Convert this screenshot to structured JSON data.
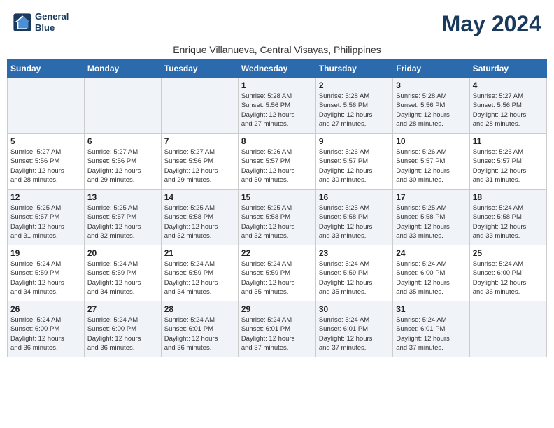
{
  "header": {
    "logo_line1": "General",
    "logo_line2": "Blue",
    "month_title": "May 2024",
    "subtitle": "Enrique Villanueva, Central Visayas, Philippines"
  },
  "weekdays": [
    "Sunday",
    "Monday",
    "Tuesday",
    "Wednesday",
    "Thursday",
    "Friday",
    "Saturday"
  ],
  "weeks": [
    [
      {
        "day": "",
        "info": ""
      },
      {
        "day": "",
        "info": ""
      },
      {
        "day": "",
        "info": ""
      },
      {
        "day": "1",
        "info": "Sunrise: 5:28 AM\nSunset: 5:56 PM\nDaylight: 12 hours\nand 27 minutes."
      },
      {
        "day": "2",
        "info": "Sunrise: 5:28 AM\nSunset: 5:56 PM\nDaylight: 12 hours\nand 27 minutes."
      },
      {
        "day": "3",
        "info": "Sunrise: 5:28 AM\nSunset: 5:56 PM\nDaylight: 12 hours\nand 28 minutes."
      },
      {
        "day": "4",
        "info": "Sunrise: 5:27 AM\nSunset: 5:56 PM\nDaylight: 12 hours\nand 28 minutes."
      }
    ],
    [
      {
        "day": "5",
        "info": "Sunrise: 5:27 AM\nSunset: 5:56 PM\nDaylight: 12 hours\nand 28 minutes."
      },
      {
        "day": "6",
        "info": "Sunrise: 5:27 AM\nSunset: 5:56 PM\nDaylight: 12 hours\nand 29 minutes."
      },
      {
        "day": "7",
        "info": "Sunrise: 5:27 AM\nSunset: 5:56 PM\nDaylight: 12 hours\nand 29 minutes."
      },
      {
        "day": "8",
        "info": "Sunrise: 5:26 AM\nSunset: 5:57 PM\nDaylight: 12 hours\nand 30 minutes."
      },
      {
        "day": "9",
        "info": "Sunrise: 5:26 AM\nSunset: 5:57 PM\nDaylight: 12 hours\nand 30 minutes."
      },
      {
        "day": "10",
        "info": "Sunrise: 5:26 AM\nSunset: 5:57 PM\nDaylight: 12 hours\nand 30 minutes."
      },
      {
        "day": "11",
        "info": "Sunrise: 5:26 AM\nSunset: 5:57 PM\nDaylight: 12 hours\nand 31 minutes."
      }
    ],
    [
      {
        "day": "12",
        "info": "Sunrise: 5:25 AM\nSunset: 5:57 PM\nDaylight: 12 hours\nand 31 minutes."
      },
      {
        "day": "13",
        "info": "Sunrise: 5:25 AM\nSunset: 5:57 PM\nDaylight: 12 hours\nand 32 minutes."
      },
      {
        "day": "14",
        "info": "Sunrise: 5:25 AM\nSunset: 5:58 PM\nDaylight: 12 hours\nand 32 minutes."
      },
      {
        "day": "15",
        "info": "Sunrise: 5:25 AM\nSunset: 5:58 PM\nDaylight: 12 hours\nand 32 minutes."
      },
      {
        "day": "16",
        "info": "Sunrise: 5:25 AM\nSunset: 5:58 PM\nDaylight: 12 hours\nand 33 minutes."
      },
      {
        "day": "17",
        "info": "Sunrise: 5:25 AM\nSunset: 5:58 PM\nDaylight: 12 hours\nand 33 minutes."
      },
      {
        "day": "18",
        "info": "Sunrise: 5:24 AM\nSunset: 5:58 PM\nDaylight: 12 hours\nand 33 minutes."
      }
    ],
    [
      {
        "day": "19",
        "info": "Sunrise: 5:24 AM\nSunset: 5:59 PM\nDaylight: 12 hours\nand 34 minutes."
      },
      {
        "day": "20",
        "info": "Sunrise: 5:24 AM\nSunset: 5:59 PM\nDaylight: 12 hours\nand 34 minutes."
      },
      {
        "day": "21",
        "info": "Sunrise: 5:24 AM\nSunset: 5:59 PM\nDaylight: 12 hours\nand 34 minutes."
      },
      {
        "day": "22",
        "info": "Sunrise: 5:24 AM\nSunset: 5:59 PM\nDaylight: 12 hours\nand 35 minutes."
      },
      {
        "day": "23",
        "info": "Sunrise: 5:24 AM\nSunset: 5:59 PM\nDaylight: 12 hours\nand 35 minutes."
      },
      {
        "day": "24",
        "info": "Sunrise: 5:24 AM\nSunset: 6:00 PM\nDaylight: 12 hours\nand 35 minutes."
      },
      {
        "day": "25",
        "info": "Sunrise: 5:24 AM\nSunset: 6:00 PM\nDaylight: 12 hours\nand 36 minutes."
      }
    ],
    [
      {
        "day": "26",
        "info": "Sunrise: 5:24 AM\nSunset: 6:00 PM\nDaylight: 12 hours\nand 36 minutes."
      },
      {
        "day": "27",
        "info": "Sunrise: 5:24 AM\nSunset: 6:00 PM\nDaylight: 12 hours\nand 36 minutes."
      },
      {
        "day": "28",
        "info": "Sunrise: 5:24 AM\nSunset: 6:01 PM\nDaylight: 12 hours\nand 36 minutes."
      },
      {
        "day": "29",
        "info": "Sunrise: 5:24 AM\nSunset: 6:01 PM\nDaylight: 12 hours\nand 37 minutes."
      },
      {
        "day": "30",
        "info": "Sunrise: 5:24 AM\nSunset: 6:01 PM\nDaylight: 12 hours\nand 37 minutes."
      },
      {
        "day": "31",
        "info": "Sunrise: 5:24 AM\nSunset: 6:01 PM\nDaylight: 12 hours\nand 37 minutes."
      },
      {
        "day": "",
        "info": ""
      }
    ]
  ]
}
